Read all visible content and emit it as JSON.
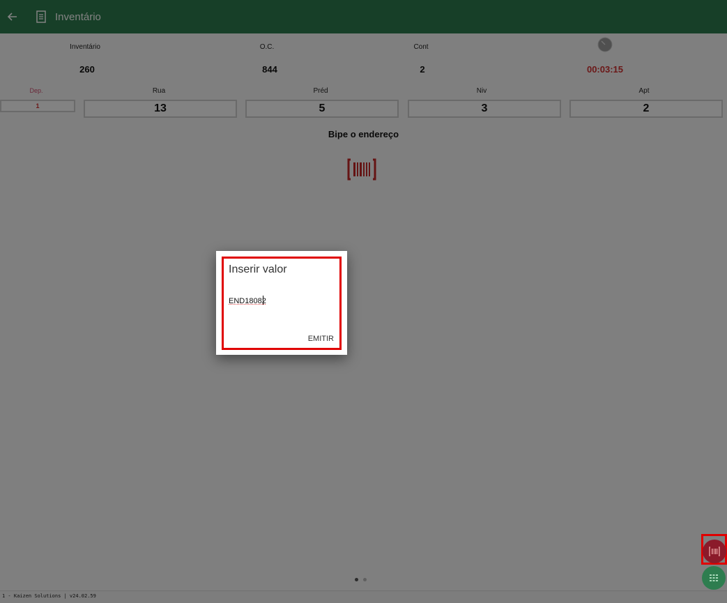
{
  "app": {
    "title": "Inventário"
  },
  "header": {
    "columns": [
      {
        "label": "Inventário",
        "value": "260"
      },
      {
        "label": "O.C.",
        "value": "844"
      },
      {
        "label": "Cont",
        "value": "2"
      }
    ],
    "timer": "00:03:15"
  },
  "address": {
    "fields": [
      {
        "label": "Dep.",
        "value": "1"
      },
      {
        "label": "Rua",
        "value": "13"
      },
      {
        "label": "Préd",
        "value": "5"
      },
      {
        "label": "Niv",
        "value": "3"
      },
      {
        "label": "Apt",
        "value": "2"
      }
    ]
  },
  "prompt": "Bipe o endereço",
  "dialog": {
    "title": "Inserir valor",
    "input_value": "END18082",
    "button_label": "EMITIR"
  },
  "footer": {
    "text": "1 - Kaizen Solutions  |  v24.02.59"
  },
  "colors": {
    "primary": "#2e7d4f",
    "accent": "#8b1a2a",
    "timer": "#d32f2f",
    "highlight": "#e00000"
  },
  "icons": {
    "back": "arrow-left-icon",
    "doc": "document-icon",
    "clock": "clock-icon",
    "barcode": "barcode-icon",
    "keypad": "keypad-icon"
  }
}
